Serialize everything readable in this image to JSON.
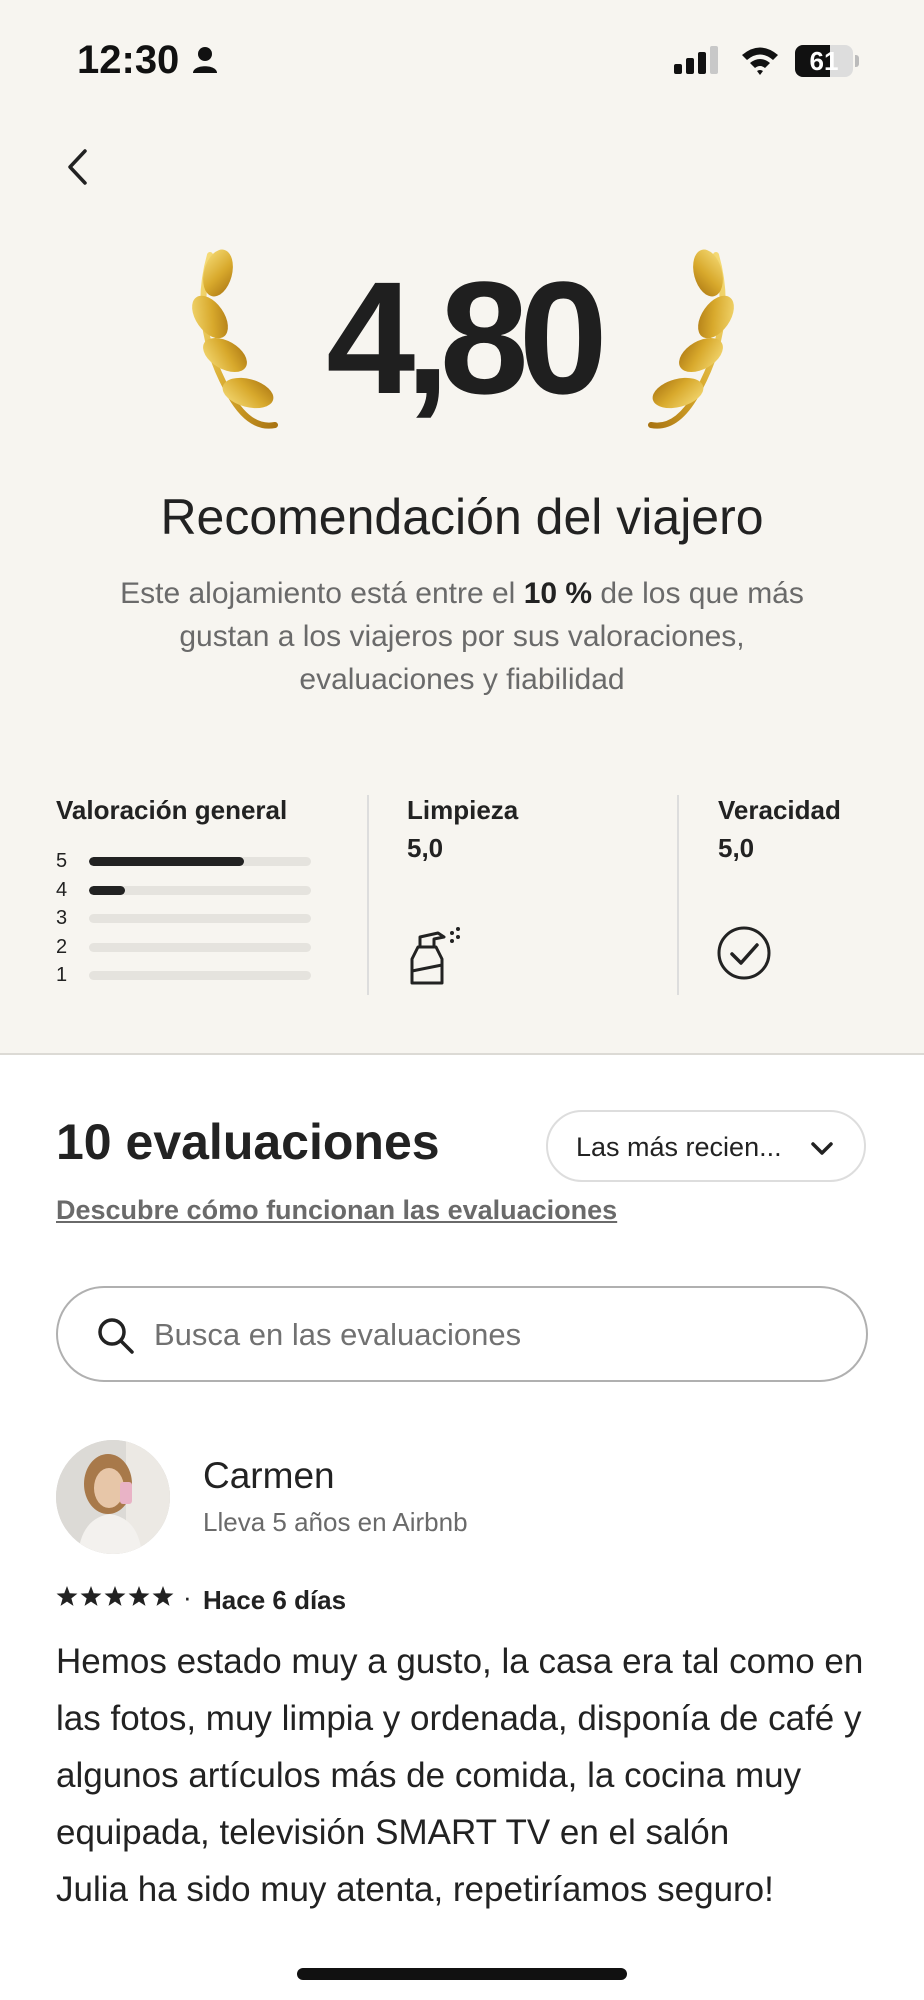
{
  "status_bar": {
    "time": "12:30",
    "battery_level": "61"
  },
  "badge": {
    "score": "4,80",
    "title": "Recomendación del viajero",
    "desc_before": "Este alojamiento está entre el ",
    "desc_bold": "10 %",
    "desc_after": " de los que más gustan a los viajeros por sus valoraciones, evaluaciones y fiabilidad"
  },
  "ratings": {
    "overall_label": "Valoración general",
    "distribution": [
      {
        "stars": "5",
        "fraction": 0.7
      },
      {
        "stars": "4",
        "fraction": 0.16
      },
      {
        "stars": "3",
        "fraction": 0
      },
      {
        "stars": "2",
        "fraction": 0
      },
      {
        "stars": "1",
        "fraction": 0
      }
    ],
    "cleanliness": {
      "label": "Limpieza",
      "value": "5,0",
      "icon": "spray-bottle-icon"
    },
    "accuracy": {
      "label": "Veracidad",
      "value": "5,0",
      "icon": "check-circle-icon"
    }
  },
  "reviews": {
    "count_label": "10 evaluaciones",
    "sort_label": "Las más recien...",
    "learn_link": "Descubre cómo funcionan las evaluaciones",
    "search_placeholder": "Busca en las evaluaciones",
    "items": [
      {
        "name": "Carmen",
        "tenure": "Lleva 5 años en Airbnb",
        "rating": 5,
        "separator": "·",
        "date": "Hace 6 días",
        "text": "Hemos estado muy a gusto, la casa era tal como en las fotos, muy limpia y ordenada, disponía de café y algunos artículos más de comida, la cocina muy equipada, televisión SMART TV en el salón\nJulia ha sido muy atenta, repetiríamos seguro!"
      }
    ]
  },
  "colors": {
    "header_bg": "#f7f5f0",
    "text": "#222222",
    "muted": "#6a6a6a",
    "gold": "#d8a92c"
  }
}
